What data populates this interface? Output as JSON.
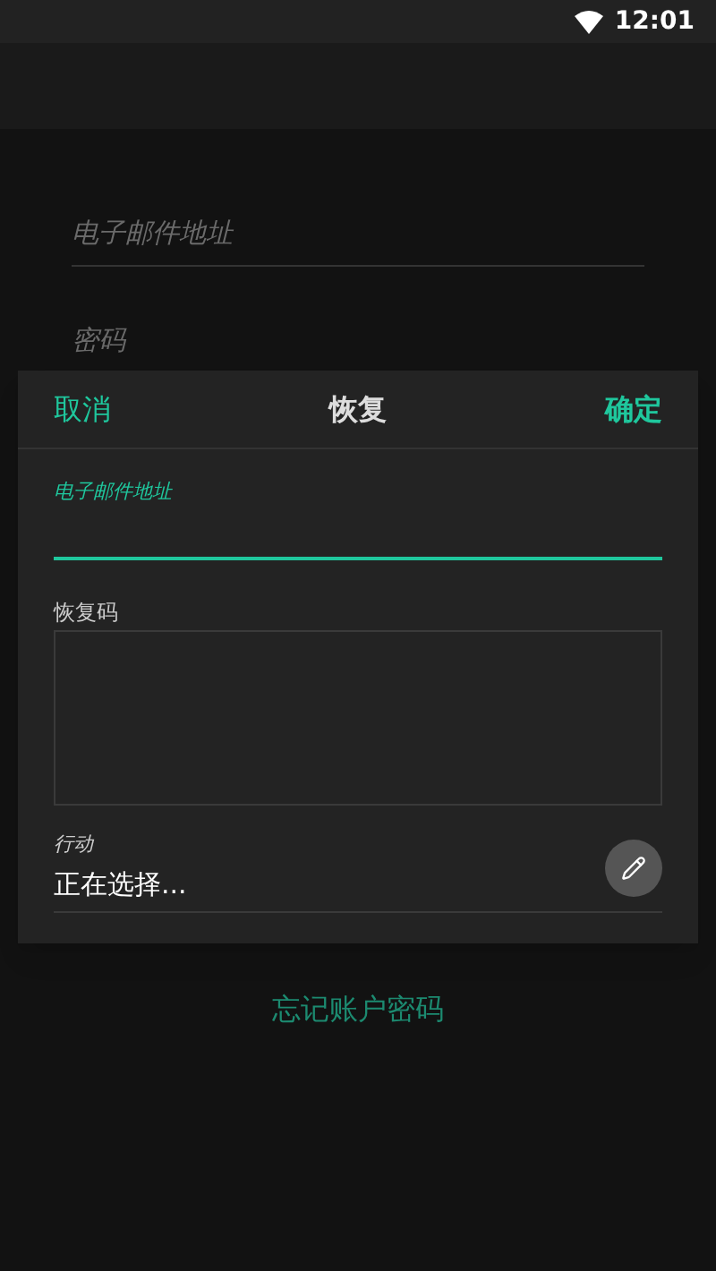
{
  "status_bar": {
    "time": "12:01"
  },
  "login_form": {
    "email": {
      "placeholder": "电子邮件地址"
    },
    "password": {
      "placeholder": "密码"
    },
    "forgot_link": "忘记账户密码"
  },
  "dialog": {
    "title": "恢复",
    "cancel": "取消",
    "confirm": "确定",
    "email": {
      "label": "电子邮件地址",
      "focused": true
    },
    "code": {
      "label": "恢复码"
    },
    "action": {
      "label": "行动",
      "value": "正在选择..."
    }
  }
}
